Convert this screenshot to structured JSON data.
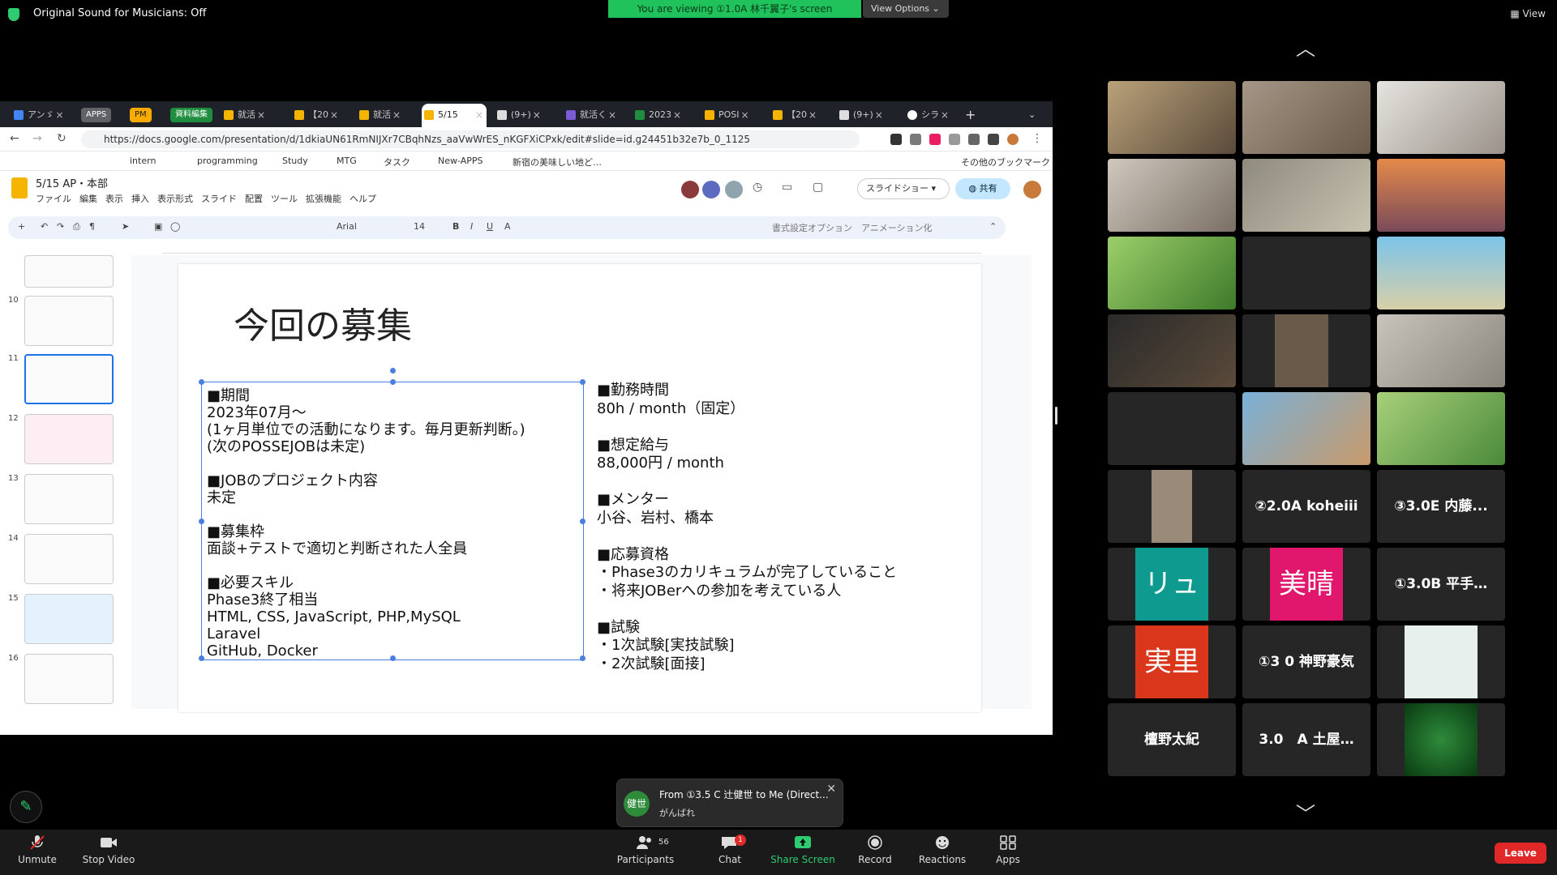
{
  "topbar": {
    "original_sound": "Original Sound for Musicians: Off",
    "viewing": "You are viewing ①1.0A 林千翼子's screen",
    "view_options": "View Options",
    "view": "View"
  },
  "browser": {
    "tabs": [
      "アンゞ",
      "APPS",
      "PM",
      "資料編集",
      "就活",
      "【20",
      "就活",
      "5/15",
      "(9+)",
      "就活く",
      "2023",
      "POSI",
      "【20",
      "(9+)",
      "シラ"
    ],
    "url": "https://docs.google.com/presentation/d/1dkiaUN61RmNIJXr7CBqhNzs_aaVwWrES_nKGFXiCPxk/edit#slide=id.g24451b32e7b_0_1125",
    "bookmarks": [
      "intern",
      "programming",
      "Study",
      "MTG",
      "タスク",
      "New-APPS",
      "新宿の美味しい地ど…",
      "その他のブックマーク"
    ]
  },
  "slides": {
    "doc_title": "5/15 AP・本部",
    "menu": [
      "ファイル",
      "編集",
      "表示",
      "挿入",
      "表示形式",
      "スライド",
      "配置",
      "ツール",
      "拡張機能",
      "ヘルプ"
    ],
    "slideshow": "スライドショー",
    "share": "共有",
    "font": "Arial",
    "font_size": "14",
    "format_options": "書式設定オプション",
    "animation": "アニメーション化",
    "slide_numbers": [
      "10",
      "11",
      "12",
      "13",
      "14",
      "15",
      "16"
    ],
    "slide_title": "今回の募集",
    "left_text": "■期間\n2023年07月〜\n(1ヶ月単位での活動になります。毎月更新判断。)\n(次のPOSSEJOBは未定)\n\n■JOBのプロジェクト内容\n未定\n\n■募集枠\n面談+テストで適切と判断された人全員\n\n■必要スキル\nPhase3終了相当\nHTML, CSS, JavaScript, PHP,MySQL\nLaravel\nGitHub, Docker",
    "right_text": "■勤務時間\n80h / month（固定）\n\n■想定給与\n88,000円 / month\n\n■メンター\n小谷、岩村、橋本\n\n■応募資格\n・Phase3のカリキュラムが完了していること\n・将来JOBerへの参加を考えている人\n\n■試験\n・1次試験[実技試験]\n・2次試験[面接]"
  },
  "gallery": {
    "names": [
      "②2.0A koheiii",
      "③3.0E 内藤...",
      "①3.0B 平手…",
      "①3 0 神野豪気",
      "檀野太紀",
      "3.0　A 土屋…"
    ],
    "tiles": [
      {
        "text": "リュ",
        "color": "#0e9a8e"
      },
      {
        "text": "美晴",
        "color": "#e0176c"
      },
      {
        "text": "実里",
        "color": "#d9361c"
      }
    ]
  },
  "toast": {
    "avatar": "健世",
    "from": "From ①3.5 C 辻健世 to Me (Direct...",
    "message": "がんばれ"
  },
  "bottombar": {
    "unmute": "Unmute",
    "stop_video": "Stop Video",
    "participants": "Participants",
    "participants_count": "56",
    "chat": "Chat",
    "chat_badge": "1",
    "share_screen": "Share Screen",
    "record": "Record",
    "reactions": "Reactions",
    "apps": "Apps",
    "leave": "Leave"
  },
  "colors": {
    "banner_green": "#1fc25b",
    "leave_red": "#e02828",
    "selection_blue": "#4a7fe0"
  }
}
